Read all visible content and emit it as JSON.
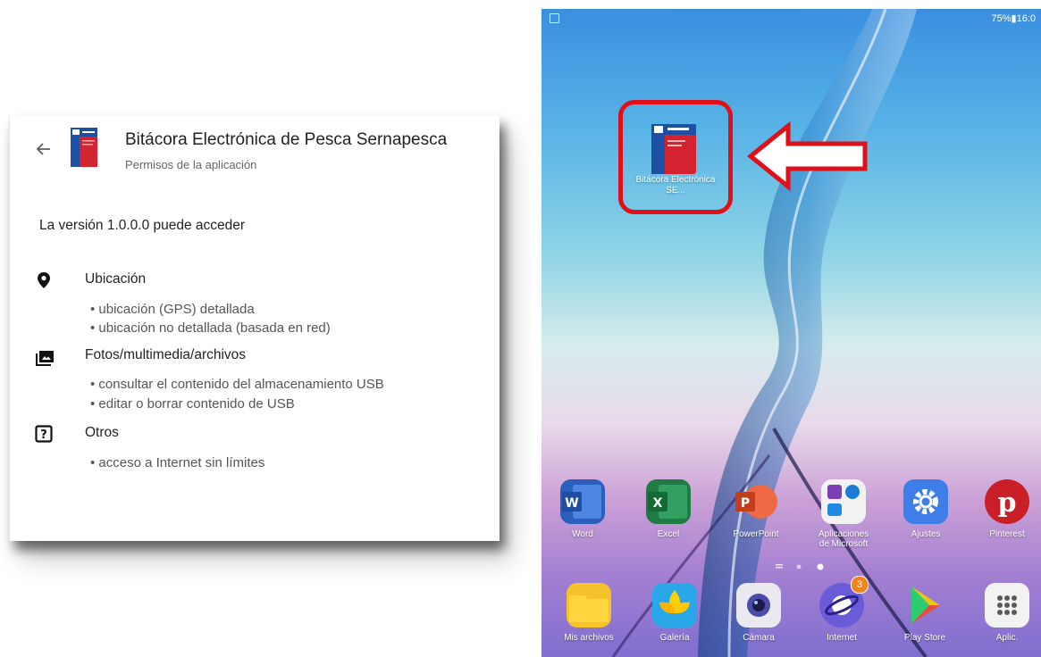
{
  "permissions_screen": {
    "app_title": "Bitácora Electrónica de Pesca Sernapesca",
    "subtitle": "Permisos de la aplicación",
    "version_text": "La versión 1.0.0.0 puede acceder",
    "groups": [
      {
        "title": "Ubicación",
        "icon": "location-pin-icon",
        "items": [
          "• ubicación (GPS) detallada",
          "• ubicación no detallada (basada en red)"
        ]
      },
      {
        "title": "Fotos/multimedia/archivos",
        "icon": "photos-folder-icon",
        "items": [
          "• consultar el contenido del almacenamiento USB",
          "• editar o borrar contenido de USB"
        ]
      },
      {
        "title": "Otros",
        "icon": "question-box-icon",
        "items": [
          "• acceso a Internet sin límites"
        ]
      }
    ]
  },
  "tablet_home": {
    "status": {
      "right_text": "75%▮16:0"
    },
    "highlighted_app": {
      "label": "Bitácora Electrónica SE..."
    },
    "row_apps": [
      {
        "label": "Word",
        "color": "#2b5fbd",
        "icon": "word-icon"
      },
      {
        "label": "Excel",
        "color": "#1f7a44",
        "icon": "excel-icon"
      },
      {
        "label": "PowerPoint",
        "color": "#d24726",
        "icon": "powerpoint-icon"
      },
      {
        "label": "Aplicaciones de Microsoft",
        "color": "#f2f2f2",
        "icon": "microsoft-folder-icon"
      },
      {
        "label": "Ajustes",
        "color": "#3f7ee8",
        "icon": "gear-icon"
      },
      {
        "label": "Pinterest",
        "color": "#cb1f27",
        "icon": "pinterest-icon"
      }
    ],
    "dock_apps": [
      {
        "label": "Mis archivos",
        "color": "#f6c22b",
        "icon": "folder-icon"
      },
      {
        "label": "Galería",
        "color": "#f5b800",
        "icon": "gallery-flower-icon"
      },
      {
        "label": "Cámara",
        "color": "#e9e9ef",
        "icon": "camera-icon"
      },
      {
        "label": "Internet",
        "color": "#6a5cd8",
        "icon": "internet-planet-icon",
        "badge": "3"
      },
      {
        "label": "Play Store",
        "color": "#ffffff",
        "icon": "play-store-icon"
      },
      {
        "label": "Aplic.",
        "color": "#f2f2f2",
        "icon": "apps-grid-icon"
      }
    ],
    "annotation_color": "#e10f18"
  }
}
